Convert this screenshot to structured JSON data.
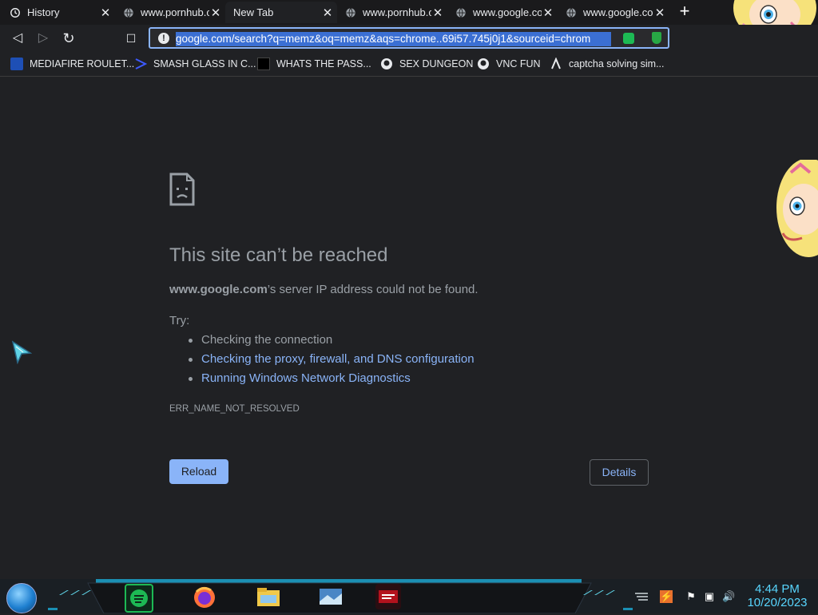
{
  "tabs": [
    {
      "title": "History",
      "icon": "history-icon",
      "close": "✕"
    },
    {
      "title": "www.pornhub.c",
      "icon": "globe-icon",
      "close": "✕"
    },
    {
      "title": "New Tab",
      "icon": "",
      "close": "✕"
    },
    {
      "title": "www.pornhub.c",
      "icon": "globe-icon",
      "close": "✕"
    },
    {
      "title": "www.google.co",
      "icon": "globe-icon",
      "close": "✕"
    },
    {
      "title": "www.google.co",
      "icon": "globe-icon",
      "close": "✕"
    }
  ],
  "new_tab_label": "+",
  "toolbar": {
    "back": "◁",
    "forward": "▷",
    "reload": "↻",
    "bookmark": "☐",
    "info": "!",
    "url": "google.com/search?q=memz&oq=memz&aqs=chrome..69i57.745j0j1&sourceid=chrom"
  },
  "bookmarks": [
    {
      "label": "MEDIAFIRE ROULET...",
      "icon": "mediafire-icon"
    },
    {
      "label": "SMASH GLASS IN C...",
      "icon": "sigma-icon"
    },
    {
      "label": "WHATS THE PASS...",
      "icon": "pass-icon"
    },
    {
      "label": "SEX DUNGEON",
      "icon": "github-icon"
    },
    {
      "label": "VNC FUN",
      "icon": "github-icon"
    },
    {
      "label": "captcha solving sim...",
      "icon": "lambda-icon"
    }
  ],
  "error": {
    "title": "This site can’t be reached",
    "host": "www.google.com",
    "desc_suffix": "’s server IP address could not be found.",
    "try_label": "Try:",
    "suggestions": [
      "Checking the connection",
      "Checking the proxy, firewall, and DNS configuration",
      "Running Windows Network Diagnostics"
    ],
    "code": "ERR_NAME_NOT_RESOLVED",
    "reload_label": "Reload",
    "details_label": "Details"
  },
  "taskbar": {
    "time": "4:44 PM",
    "date": "10/20/2023"
  },
  "colors": {
    "accent": "#8ab4f8",
    "background": "#202124",
    "muted_text": "#9aa0a6"
  }
}
